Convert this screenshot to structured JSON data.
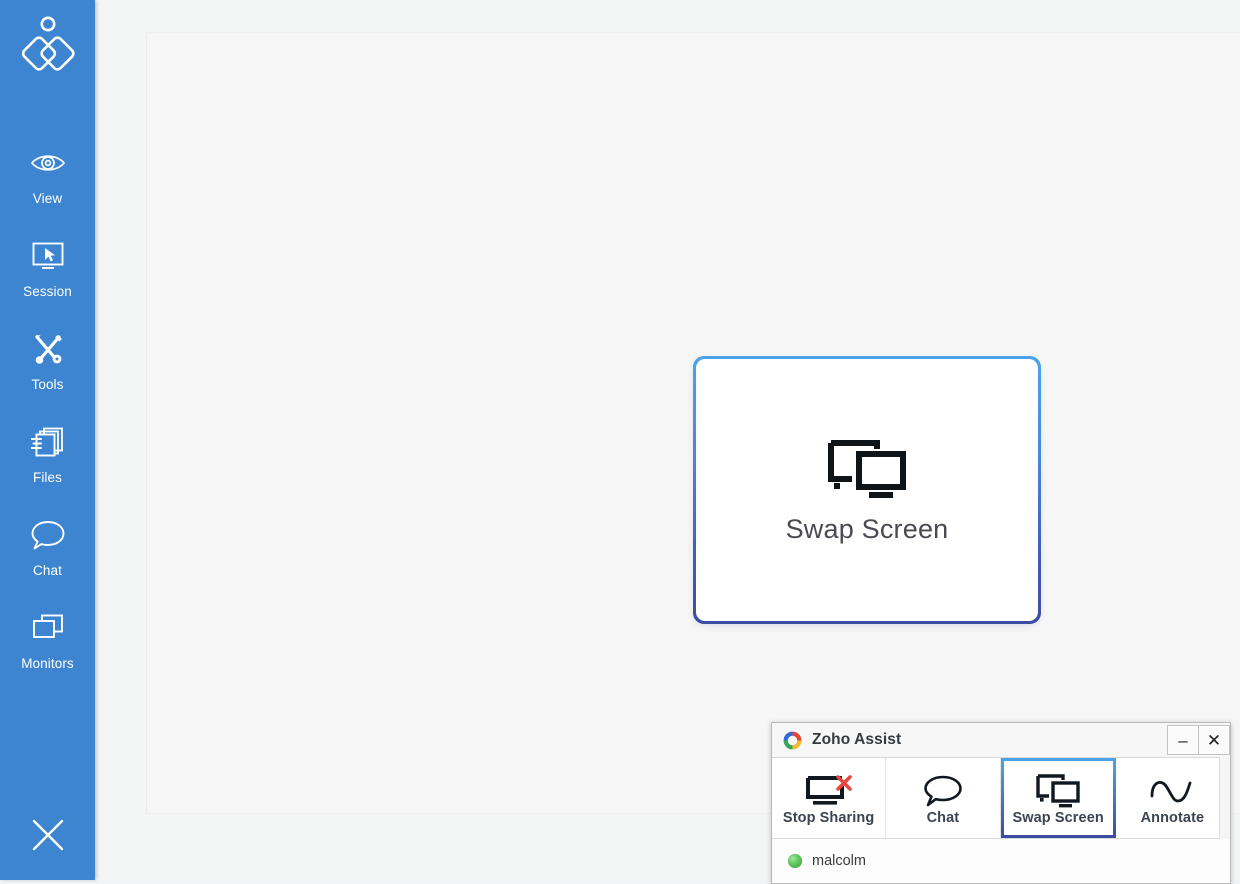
{
  "sidebar": {
    "logo_name": "zoho-assist-logo",
    "items": [
      {
        "label": "View",
        "icon": "eye-icon"
      },
      {
        "label": "Session",
        "icon": "monitor-cursor-icon"
      },
      {
        "label": "Tools",
        "icon": "tools-icon"
      },
      {
        "label": "Files",
        "icon": "files-icon"
      },
      {
        "label": "Chat",
        "icon": "chat-bubble-icon"
      },
      {
        "label": "Monitors",
        "icon": "monitors-icon"
      }
    ],
    "close_icon": "close-icon",
    "background_color": "#3d85d0"
  },
  "main": {
    "swap_card": {
      "label": "Swap Screen",
      "icon": "swap-screen-icon",
      "border_gradient_top": "#4ba3e9",
      "border_gradient_bottom": "#3b4da3"
    }
  },
  "zoho_window": {
    "title": "Zoho Assist",
    "logo_icon": "zoho-ring-logo",
    "window_controls": [
      {
        "name": "minimize-button",
        "glyph": "–"
      },
      {
        "name": "close-button",
        "glyph": "✕"
      }
    ],
    "toolbar": [
      {
        "label": "Stop Sharing",
        "icon": "stop-sharing-icon",
        "selected": false
      },
      {
        "label": "Chat",
        "icon": "chat-bubble-icon",
        "selected": false
      },
      {
        "label": "Swap Screen",
        "icon": "swap-screen-icon",
        "selected": true
      },
      {
        "label": "Annotate",
        "icon": "annotate-wave-icon",
        "selected": false
      }
    ],
    "status": {
      "participant": "malcolm",
      "presence": "online",
      "presence_color": "#5dc85a"
    },
    "selected_accent_top": "#4ba3e9",
    "selected_accent_bottom": "#3b4da3"
  }
}
